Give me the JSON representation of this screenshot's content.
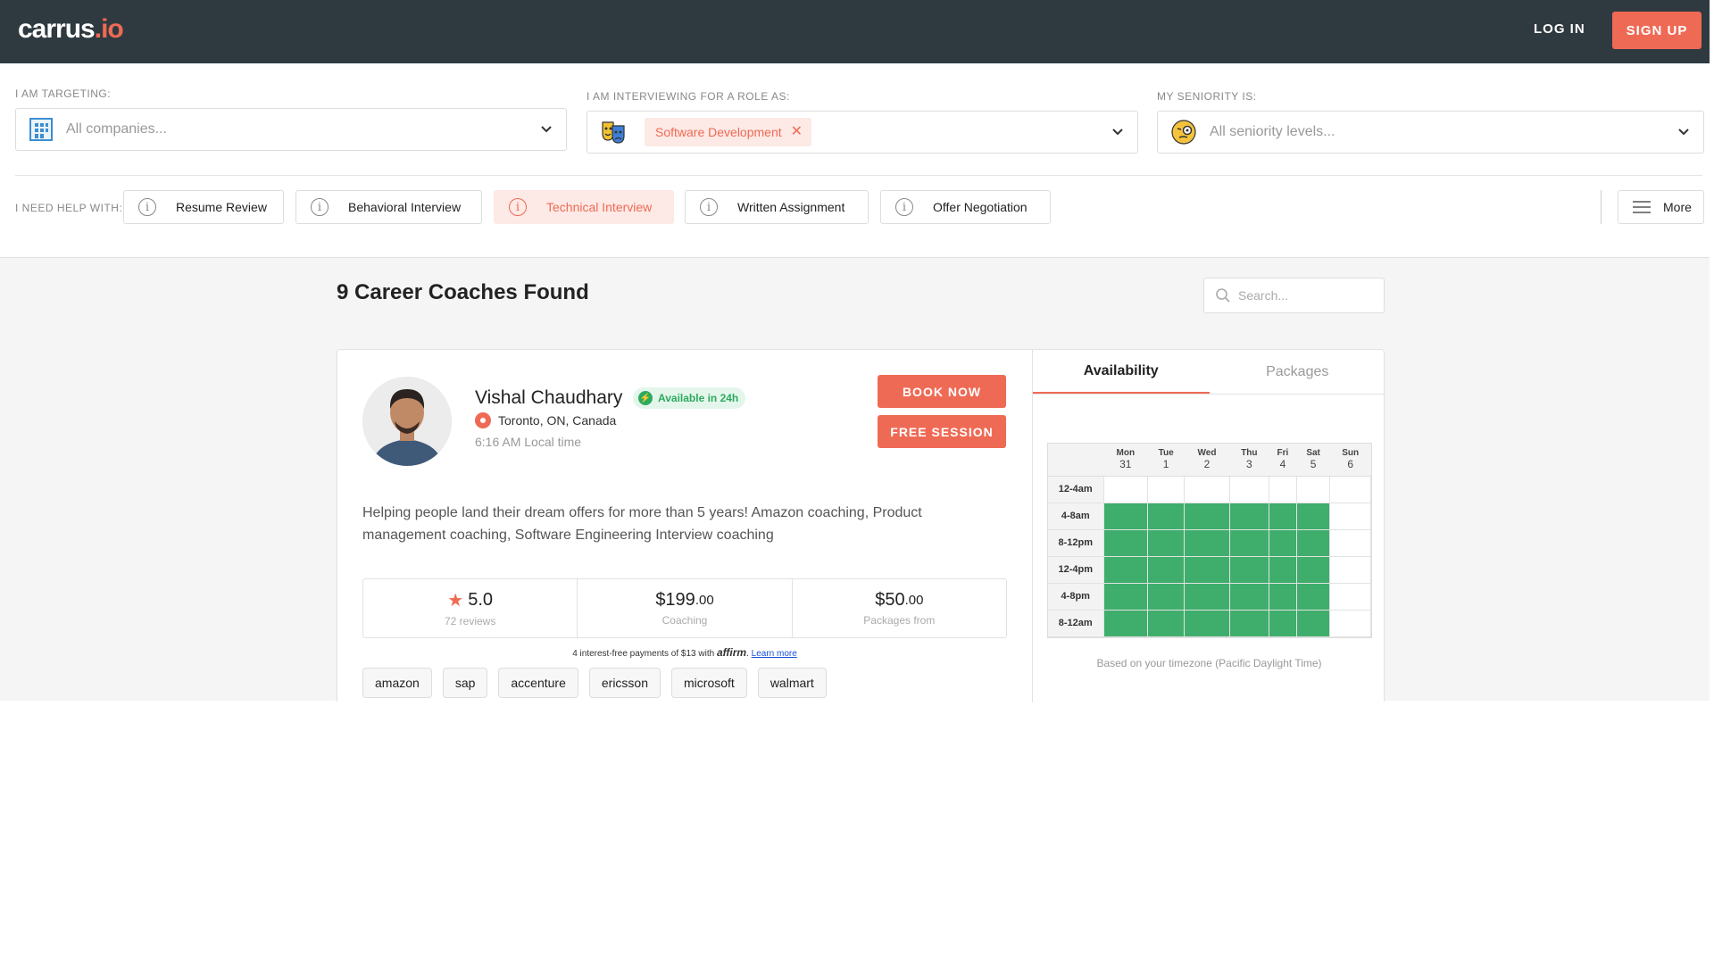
{
  "header": {
    "logo_main": "carrus",
    "logo_suffix": ".io",
    "login_label": "LOG IN",
    "signup_label": "SIGN UP"
  },
  "filters": {
    "targeting": {
      "label": "I AM TARGETING:",
      "placeholder": "All companies..."
    },
    "role": {
      "label": "I AM INTERVIEWING FOR A ROLE AS:",
      "chip": "Software Development"
    },
    "seniority": {
      "label": "MY SENIORITY IS:",
      "placeholder": "All seniority levels..."
    }
  },
  "help": {
    "label": "I NEED HELP WITH:",
    "items": [
      {
        "label": "Resume Review",
        "active": false
      },
      {
        "label": "Behavioral Interview",
        "active": false
      },
      {
        "label": "Technical Interview",
        "active": true
      },
      {
        "label": "Written Assignment",
        "active": false
      },
      {
        "label": "Offer Negotiation",
        "active": false
      }
    ],
    "more_label": "More"
  },
  "results": {
    "count_title": "9 Career Coaches Found",
    "search_placeholder": "Search..."
  },
  "coach": {
    "name": "Vishal Chaudhary",
    "availability_badge": "Available in 24h",
    "location": "Toronto, ON, Canada",
    "local_time": "6:16 AM Local time",
    "book_label": "BOOK NOW",
    "free_label": "FREE SESSION",
    "bio": "Helping people land their dream offers for more than 5 years! Amazon coaching, Product management coaching, Software Engineering Interview coaching",
    "rating": "5.0",
    "reviews": "72 reviews",
    "coaching_price_main": "$199",
    "coaching_price_cents": ".00",
    "coaching_label": "Coaching",
    "packages_price_main": "$50",
    "packages_price_cents": ".00",
    "packages_label": "Packages from",
    "affirm_text": "4 interest-free payments of $13 with",
    "affirm_brand": "affirm",
    "affirm_link": "Learn more",
    "tags": [
      "amazon",
      "sap",
      "accenture",
      "ericsson",
      "microsoft",
      "walmart"
    ]
  },
  "schedule": {
    "tabs": [
      "Availability",
      "Packages"
    ],
    "active_tab": 0,
    "days": [
      {
        "day": "Mon",
        "date": "31"
      },
      {
        "day": "Tue",
        "date": "1"
      },
      {
        "day": "Wed",
        "date": "2"
      },
      {
        "day": "Thu",
        "date": "3"
      },
      {
        "day": "Fri",
        "date": "4"
      },
      {
        "day": "Sat",
        "date": "5"
      },
      {
        "day": "Sun",
        "date": "6"
      }
    ],
    "slots": [
      "12-4am",
      "4-8am",
      "8-12pm",
      "12-4pm",
      "4-8pm",
      "8-12am"
    ],
    "available": [
      [
        0,
        0,
        0,
        0,
        0,
        0,
        0
      ],
      [
        1,
        1,
        1,
        1,
        1,
        1,
        0
      ],
      [
        1,
        1,
        1,
        1,
        1,
        1,
        0
      ],
      [
        1,
        1,
        1,
        1,
        1,
        1,
        0
      ],
      [
        1,
        1,
        1,
        1,
        1,
        1,
        0
      ],
      [
        1,
        1,
        1,
        1,
        1,
        1,
        0
      ]
    ],
    "timezone_note": "Based on your timezone (Pacific Daylight Time)",
    "available_color": "#3fae6c"
  },
  "colors": {
    "accent": "#ef6a55",
    "topbar": "#2f3a40",
    "success": "#2eaa5f"
  }
}
